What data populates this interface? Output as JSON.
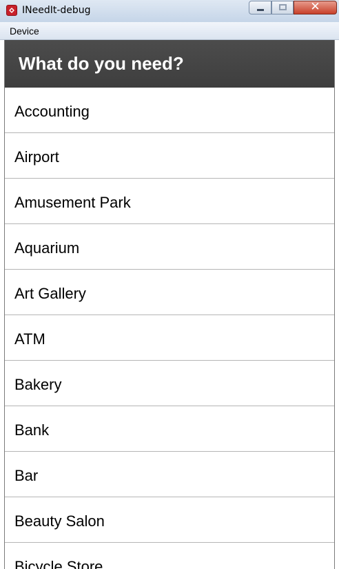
{
  "window": {
    "title": "INeedIt-debug",
    "app_icon": "app-icon",
    "controls": [
      "minimize-icon",
      "maximize-icon",
      "close-icon"
    ],
    "close_glyph": "✕"
  },
  "menubar": {
    "device_label": "Device"
  },
  "action_bar": {
    "title": "What do you need?",
    "background": "#454545"
  },
  "list": {
    "items": [
      "Accounting",
      "Airport",
      "Amusement Park",
      "Aquarium",
      "Art Gallery",
      "ATM",
      "Bakery",
      "Bank",
      "Bar",
      "Beauty Salon",
      "Bicycle Store"
    ]
  }
}
